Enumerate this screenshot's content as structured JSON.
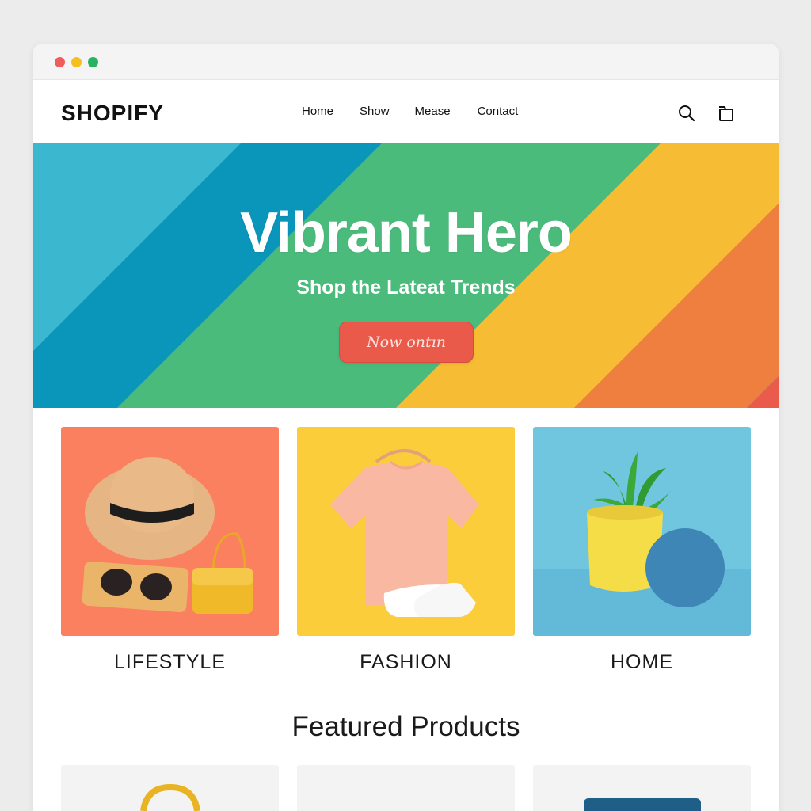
{
  "window": {
    "controls": [
      "close-dot",
      "minimize-dot",
      "maximize-dot"
    ]
  },
  "navbar": {
    "brand": "SHOPIFY",
    "links": [
      "Home",
      "Show",
      "Mease",
      "Contact"
    ],
    "icons": [
      "search-icon",
      "cart-icon"
    ]
  },
  "hero": {
    "title": "Vibrant Hero",
    "subtitle": "Shop the Lateat Trends",
    "cta_label": "Now ontın",
    "stripe_colors": [
      "#3bb7cf",
      "#0a95bb",
      "#4bbb7c",
      "#f6bd34",
      "#ee7f3f",
      "#ea5b4c"
    ]
  },
  "categories": [
    {
      "label": "LIFESTYLE",
      "bg": "#fb8060"
    },
    {
      "label": "FASHION",
      "bg": "#fbcd3a"
    },
    {
      "label": "HOME",
      "bg": "#71c6df"
    }
  ],
  "featured": {
    "title": "Featured Products"
  }
}
